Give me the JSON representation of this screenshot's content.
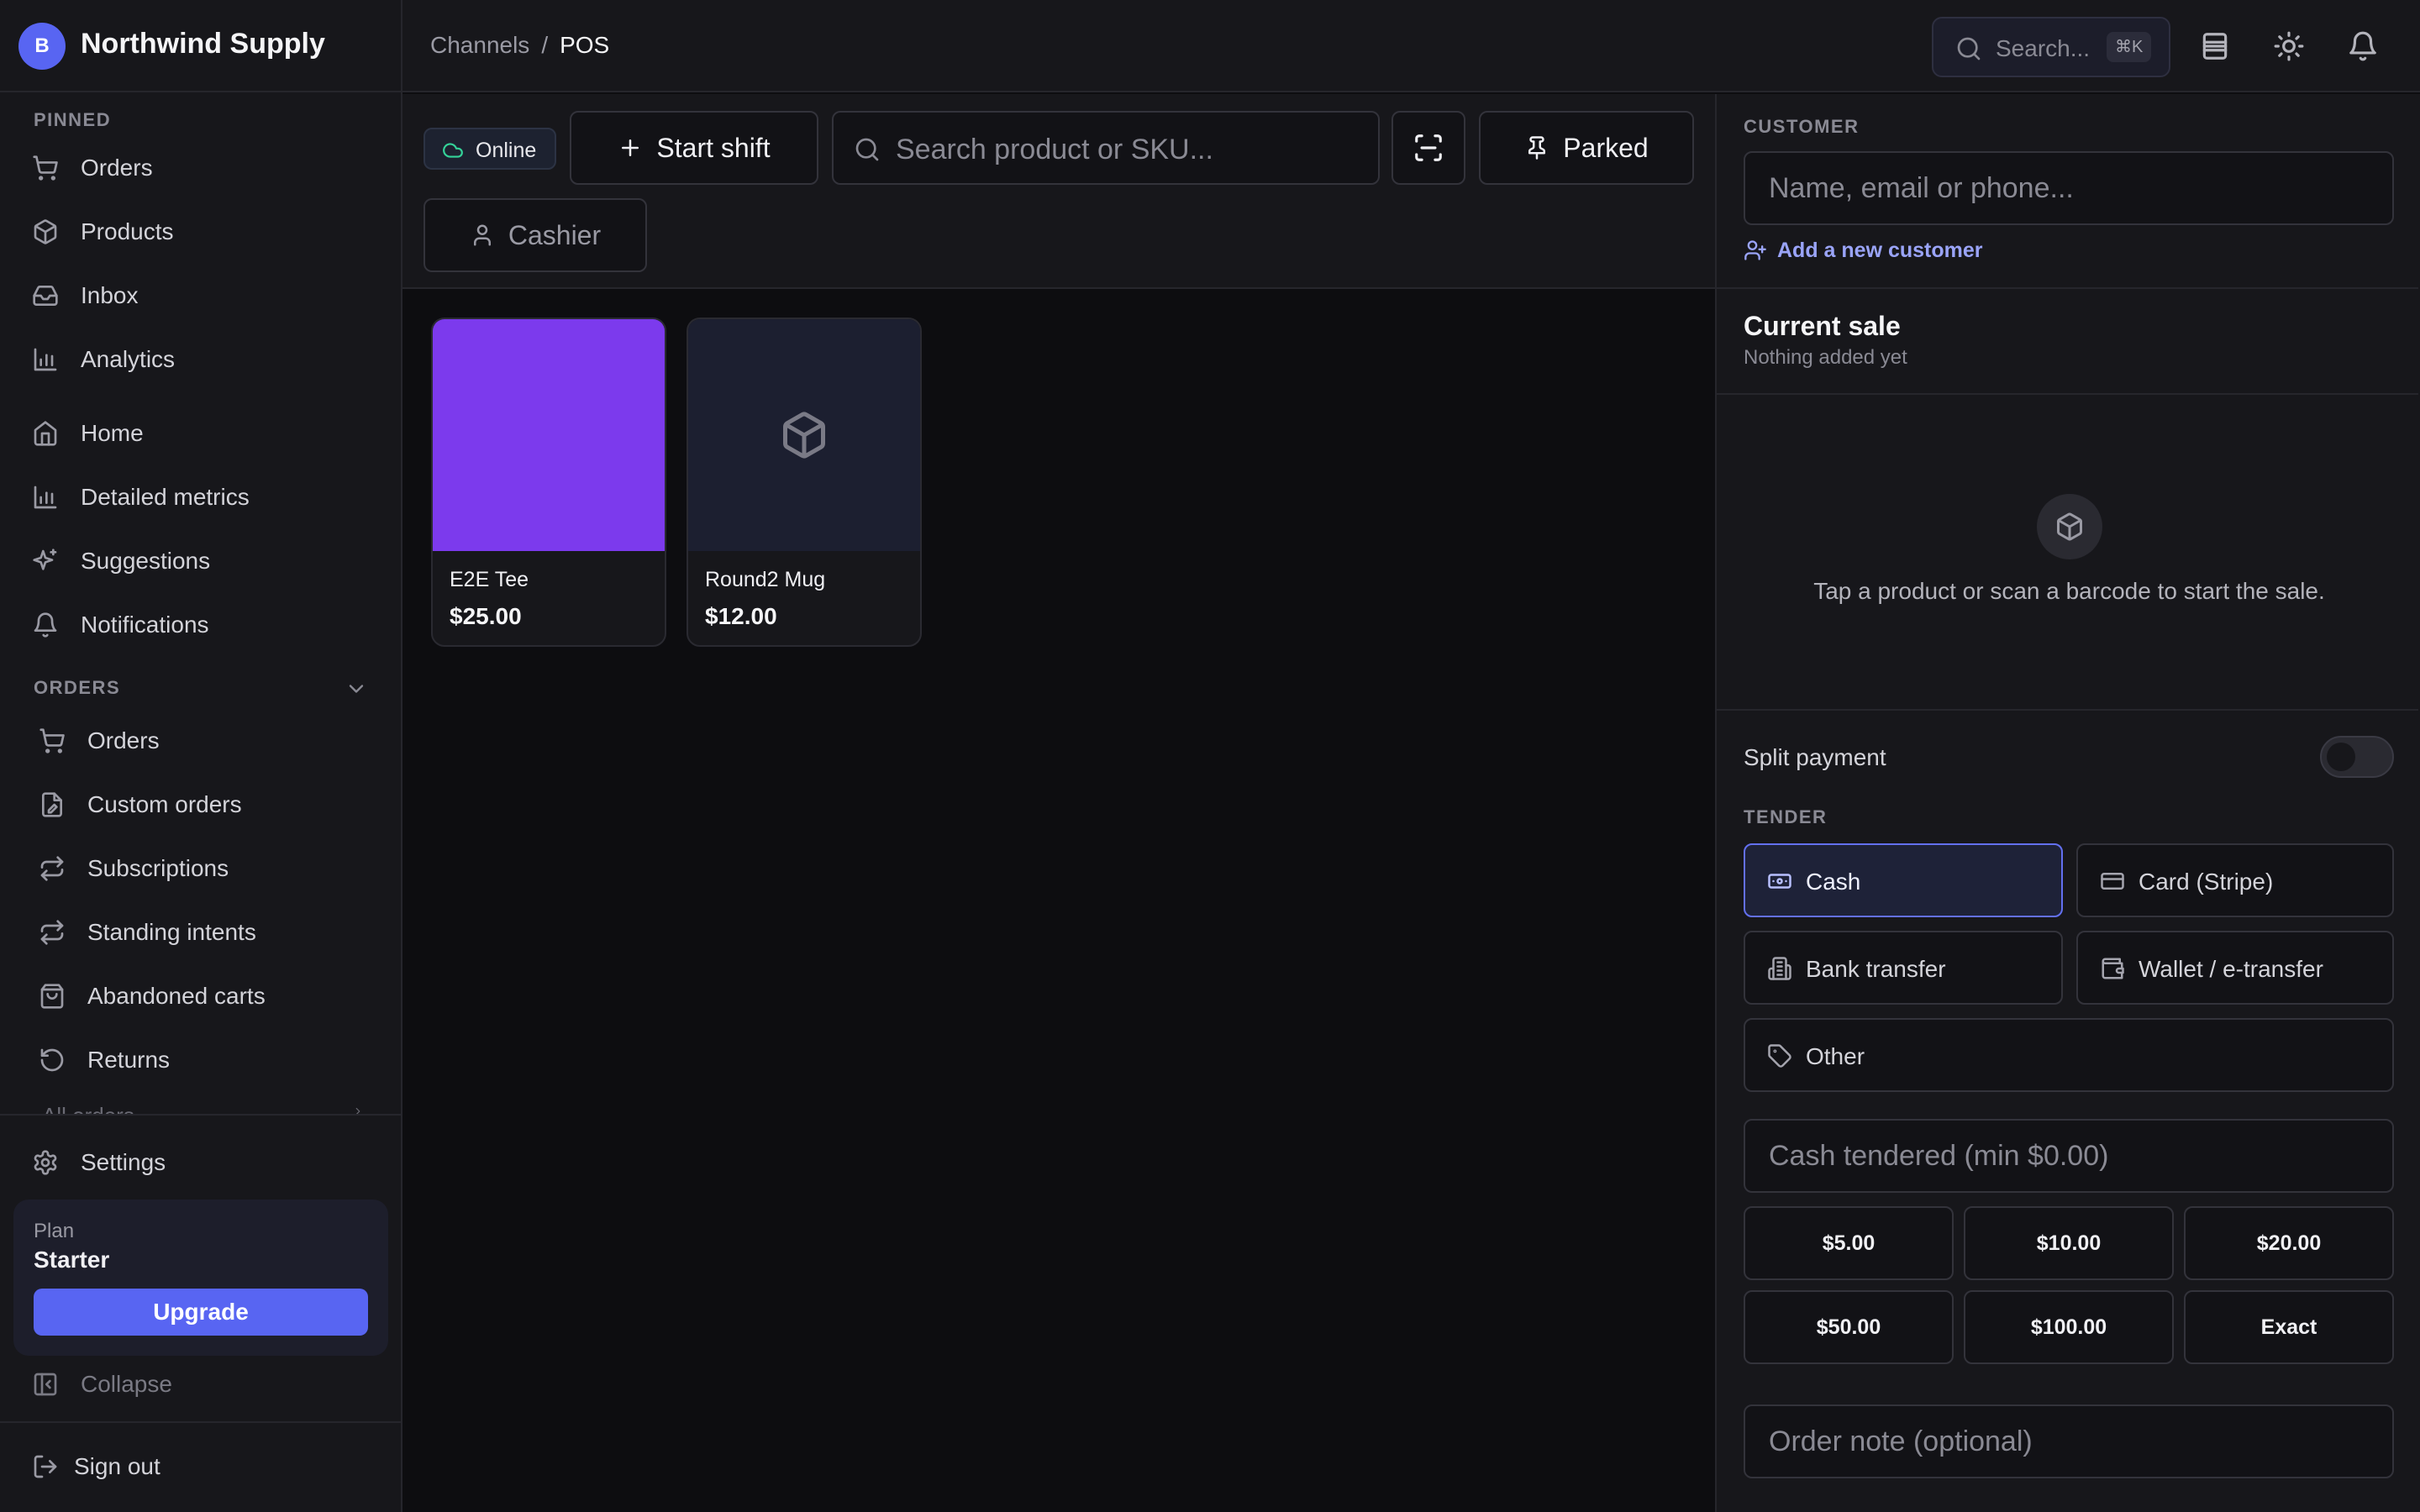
{
  "app": {
    "brand_initial": "B",
    "brand_name": "Northwind Supply",
    "accent": "#5865f2"
  },
  "sidebar": {
    "pinned_label": "PINNED",
    "pinned": [
      {
        "label": "Orders",
        "icon": "cart-icon"
      },
      {
        "label": "Products",
        "icon": "box-icon"
      },
      {
        "label": "Inbox",
        "icon": "inbox-icon"
      },
      {
        "label": "Analytics",
        "icon": "bar-chart-icon"
      }
    ],
    "main": [
      {
        "label": "Home",
        "icon": "home-icon"
      },
      {
        "label": "Detailed metrics",
        "icon": "bar-chart-icon"
      },
      {
        "label": "Suggestions",
        "icon": "sparkle-icon"
      },
      {
        "label": "Notifications",
        "icon": "bell-icon"
      }
    ],
    "orders_label": "ORDERS",
    "orders": [
      {
        "label": "Orders",
        "icon": "cart-icon"
      },
      {
        "label": "Custom orders",
        "icon": "custom-order-icon"
      },
      {
        "label": "Subscriptions",
        "icon": "repeat-icon"
      },
      {
        "label": "Standing intents",
        "icon": "repeat-icon"
      },
      {
        "label": "Abandoned carts",
        "icon": "shopping-bag-icon"
      },
      {
        "label": "Returns",
        "icon": "rotate-ccw-icon"
      }
    ],
    "all_orders": "All orders",
    "settings": "Settings",
    "plan": {
      "label": "Plan",
      "name": "Starter",
      "upgrade": "Upgrade"
    },
    "collapse": "Collapse",
    "sign_out": "Sign out"
  },
  "topbar": {
    "breadcrumb": {
      "parent": "Channels",
      "separator": "/",
      "current": "POS"
    },
    "search_placeholder": "Search...",
    "search_shortcut": "⌘K",
    "icons": [
      "table-icon",
      "sun-icon",
      "bell-icon"
    ]
  },
  "toolbar": {
    "status": "Online",
    "start_shift": "Start shift",
    "search_placeholder": "Search product or SKU...",
    "parked": "Parked",
    "cashier": "Cashier"
  },
  "products": [
    {
      "name": "E2E Tee",
      "price": "$25.00",
      "thumb_color": "#7c3aed",
      "has_image": true
    },
    {
      "name": "Round2 Mug",
      "price": "$12.00",
      "thumb_color": "#1c1f30",
      "has_image": false
    }
  ],
  "customer": {
    "label": "CUSTOMER",
    "placeholder": "Name, email or phone...",
    "add_new": "Add a new customer"
  },
  "sale": {
    "title": "Current sale",
    "subtitle": "Nothing added yet",
    "empty_message": "Tap a product or scan a barcode to start the sale."
  },
  "payment": {
    "split_label": "Split payment",
    "split_enabled": false,
    "tender_label": "TENDER",
    "tenders": [
      {
        "label": "Cash",
        "icon": "cash-icon",
        "selected": true
      },
      {
        "label": "Card (Stripe)",
        "icon": "credit-card-icon",
        "selected": false
      },
      {
        "label": "Bank transfer",
        "icon": "bank-icon",
        "selected": false
      },
      {
        "label": "Wallet / e-transfer",
        "icon": "wallet-icon",
        "selected": false
      },
      {
        "label": "Other",
        "icon": "tag-icon",
        "selected": false
      }
    ],
    "cash_placeholder": "Cash tendered (min $0.00)",
    "quick_amounts": [
      "$5.00",
      "$10.00",
      "$20.00",
      "$50.00",
      "$100.00",
      "Exact"
    ],
    "note_placeholder": "Order note (optional)"
  }
}
